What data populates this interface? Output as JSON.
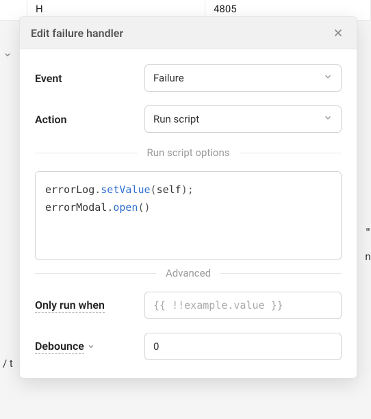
{
  "background": {
    "row_letter": "H",
    "row_value": "4805",
    "right_fragment_1": "\"",
    "right_fragment_2": "n",
    "bottom_fragment": "/ t"
  },
  "modal": {
    "title": "Edit failure handler"
  },
  "event": {
    "label": "Event",
    "value": "Failure"
  },
  "action": {
    "label": "Action",
    "value": "Run script"
  },
  "sections": {
    "run_script_options": "Run script options",
    "advanced": "Advanced"
  },
  "code": {
    "line1_obj": "errorLog",
    "line1_dot": ".",
    "line1_method": "setValue",
    "line1_open": "(",
    "line1_arg": "self",
    "line1_close": ");",
    "line2_obj": "errorModal",
    "line2_dot": ".",
    "line2_method": "open",
    "line2_parens": "()"
  },
  "only_run_when": {
    "label": "Only run when",
    "placeholder": "{{ !!example.value }}"
  },
  "debounce": {
    "label": "Debounce",
    "value": "0"
  }
}
